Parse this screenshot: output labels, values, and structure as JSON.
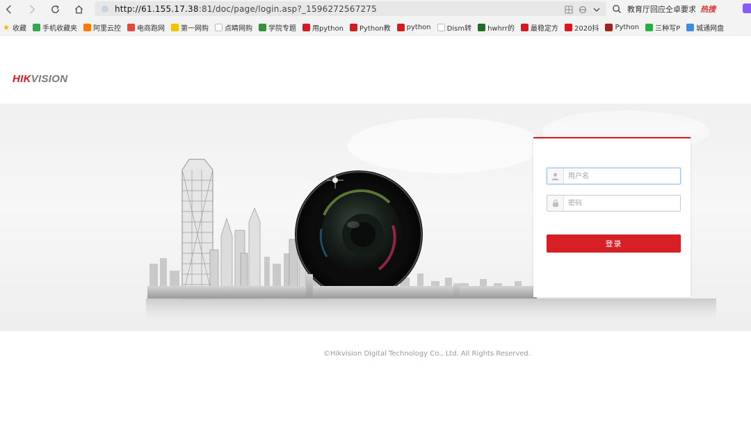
{
  "browser": {
    "url_host": "http://61.155.17.38",
    "url_rest": ":81/doc/page/login.asp?_1596272567275",
    "search_text": "教育厅回应仝卓要求",
    "search_badge": "热搜"
  },
  "bookmarks": [
    {
      "label": "收藏",
      "icon": "star-icon",
      "color": "#f5b400"
    },
    {
      "label": "手机收藏夹",
      "icon": "phone-icon",
      "color": "#33a852"
    },
    {
      "label": "阿里云控",
      "icon": "aliyun-icon",
      "color": "#ff7a00"
    },
    {
      "label": "电商跑网",
      "icon": "shop-icon",
      "color": "#e8453c"
    },
    {
      "label": "第一网购",
      "icon": "medal-icon",
      "color": "#f2c200"
    },
    {
      "label": "点睛网购",
      "icon": "page-icon",
      "color": "#bdbdbd"
    },
    {
      "label": "学院专题",
      "icon": "school-icon",
      "color": "#3a8f3a"
    },
    {
      "label": "用python",
      "icon": "csdn-icon",
      "color": "#d71920"
    },
    {
      "label": "Python教",
      "icon": "csdn-icon",
      "color": "#d71920"
    },
    {
      "label": "python",
      "icon": "csdn-icon",
      "color": "#d71920"
    },
    {
      "label": "Dism转",
      "icon": "page-icon",
      "color": "#bdbdbd"
    },
    {
      "label": "hwhrr的",
      "icon": "fc-icon",
      "color": "#1f6b2a"
    },
    {
      "label": "最稳定方",
      "icon": "csdn-icon",
      "color": "#d71920"
    },
    {
      "label": "2020抖",
      "icon": "csdn-icon",
      "color": "#d71920"
    },
    {
      "label": "Python",
      "icon": "python-icon",
      "color": "#a0221c"
    },
    {
      "label": "三种写P",
      "icon": "wechat-icon",
      "color": "#2aae43"
    },
    {
      "label": "城通网盘",
      "icon": "ct-icon",
      "color": "#3c8ce6"
    }
  ],
  "page": {
    "logo_hik": "HIK",
    "logo_vision": "VISION",
    "username_placeholder": "用户名",
    "password_placeholder": "密码",
    "login_label": "登录",
    "footer": "©Hikvision Digital Technology Co., Ltd. All Rights Reserved."
  },
  "colors": {
    "accent": "#d71920",
    "chrome_bg": "#f3f3f3"
  }
}
